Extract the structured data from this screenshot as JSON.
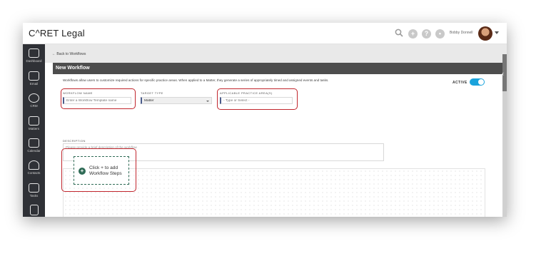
{
  "app": {
    "logo": "C^RET Legal"
  },
  "topbar": {
    "user_name": "Bobby Donnell",
    "icons": [
      "search-icon",
      "plus-icon",
      "help-icon",
      "chat-icon"
    ]
  },
  "nav": {
    "items": [
      {
        "label": "Dashboard",
        "icon": "dashboard-icon"
      },
      {
        "label": "Email",
        "icon": "email-icon"
      },
      {
        "label": "CRM",
        "icon": "crm-icon"
      },
      {
        "label": "Matters",
        "icon": "matters-icon"
      },
      {
        "label": "Calendar",
        "icon": "calendar-icon"
      },
      {
        "label": "Contacts",
        "icon": "contacts-icon"
      },
      {
        "label": "Tasks",
        "icon": "tasks-icon"
      },
      {
        "label": "",
        "icon": "documents-icon"
      }
    ]
  },
  "breadcrumb": {
    "back": "Back to Workflows"
  },
  "page": {
    "title": "New Workflow",
    "intro": "Workflows allow users to customize required actions for specific practice areas. When applied to a Matter, they generate a series of appropriately timed and assigned events and tasks.",
    "active_label": "ACTIVE",
    "active": true
  },
  "form": {
    "workflow_name": {
      "label": "WORKFLOW NAME",
      "placeholder": "Enter a Workflow Template name"
    },
    "target_type": {
      "label": "TARGET TYPE",
      "value": "Matter"
    },
    "practice_areas": {
      "label": "APPLICABLE PRACTICE AREA(S)",
      "placeholder": "- Type or Select -"
    },
    "description": {
      "label": "DESCRIPTION",
      "placeholder": "Please provide a brief description of the workflow"
    }
  },
  "steps": {
    "add_label": "Click + to add Workflow Steps",
    "add_symbol": "+"
  },
  "colors": {
    "highlight": "#c1262d",
    "toggle": "#1aa3dc",
    "nav": "#2f3136",
    "accent_green": "#2f6b56"
  }
}
